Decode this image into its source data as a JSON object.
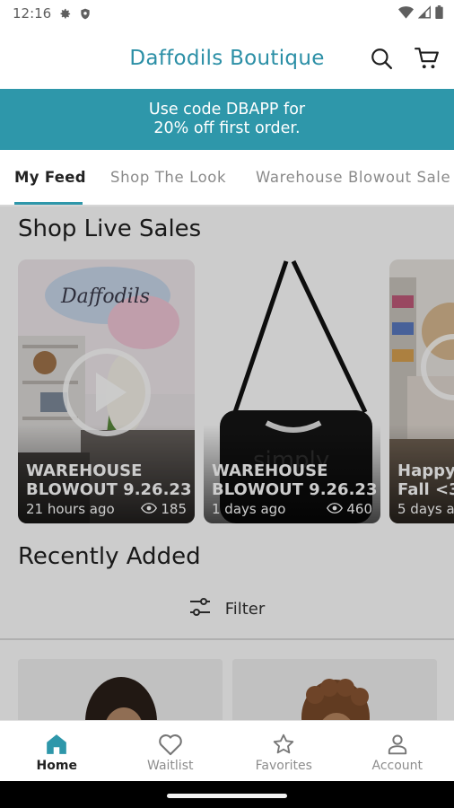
{
  "status_bar": {
    "time": "12:16",
    "icons": [
      "gear-icon",
      "shield-icon",
      "wifi-icon",
      "signal-icon",
      "battery-icon"
    ]
  },
  "header": {
    "title": "Daffodils Boutique",
    "icons": [
      "search-icon",
      "cart-icon"
    ]
  },
  "promo": {
    "line1": "Use code DBAPP for",
    "line2": "20% off first order."
  },
  "tabs": [
    {
      "label": "My Feed",
      "active": true
    },
    {
      "label": "Shop The Look",
      "active": false
    },
    {
      "label": "Warehouse Blowout Sale",
      "active": false
    }
  ],
  "live_sales": {
    "title": "Shop Live Sales",
    "cards": [
      {
        "title": "WAREHOUSE\nBLOWOUT 9.26.23",
        "time": "21 hours ago",
        "views": "185",
        "play_icon": "play-icon"
      },
      {
        "title": "WAREHOUSE\nBLOWOUT 9.26.23",
        "time": "1 days ago",
        "views": "460"
      },
      {
        "title": "Happy\nFall <3",
        "time": "5 days a",
        "views": ""
      }
    ]
  },
  "recently_added": {
    "title": "Recently Added",
    "filter_label": "Filter",
    "filter_icon": "sliders-icon"
  },
  "bottom_nav": [
    {
      "label": "Home",
      "icon": "home-icon",
      "active": true
    },
    {
      "label": "Waitlist",
      "icon": "heart-icon",
      "active": false
    },
    {
      "label": "Favorites",
      "icon": "star-icon",
      "active": false
    },
    {
      "label": "Account",
      "icon": "person-icon",
      "active": false
    }
  ],
  "colors": {
    "accent": "#2e97aa",
    "title": "#2b8fa6"
  }
}
